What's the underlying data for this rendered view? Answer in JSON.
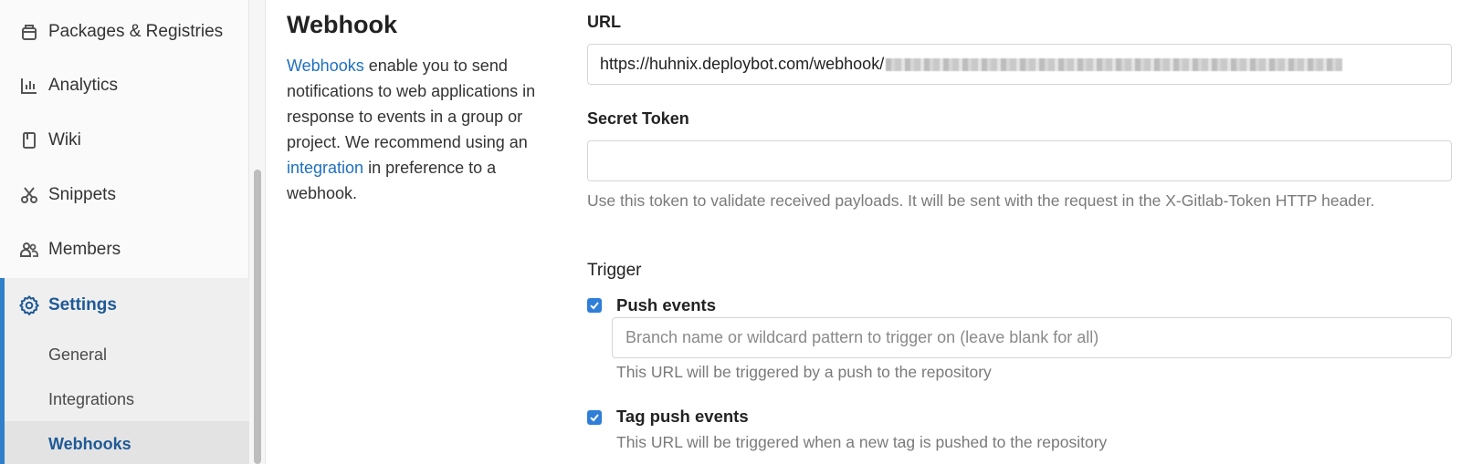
{
  "sidebar": {
    "items": [
      {
        "label": "Packages & Registries",
        "icon": "package-icon"
      },
      {
        "label": "Analytics",
        "icon": "analytics-icon"
      },
      {
        "label": "Wiki",
        "icon": "book-icon"
      },
      {
        "label": "Snippets",
        "icon": "snippet-icon"
      },
      {
        "label": "Members",
        "icon": "users-icon"
      },
      {
        "label": "Settings",
        "icon": "gear-icon"
      }
    ],
    "subitems": [
      "General",
      "Integrations",
      "Webhooks"
    ]
  },
  "description": {
    "title": "Webhook",
    "link_webhooks": "Webhooks",
    "text1": " enable you to send notifications to web applications in response to events in a group or project. We recommend using an ",
    "link_integration": "integration",
    "text2": " in preference to a webhook."
  },
  "form": {
    "url_label": "URL",
    "url_value": "https://huhnix.deploybot.com/webhook/",
    "secret_label": "Secret Token",
    "secret_value": "",
    "secret_help": "Use this token to validate received payloads. It will be sent with the request in the X-Gitlab-Token HTTP header.",
    "trigger_label": "Trigger",
    "push_label": "Push events",
    "push_checked": true,
    "branch_placeholder": "Branch name or wildcard pattern to trigger on (leave blank for all)",
    "push_help": "This URL will be triggered by a push to the repository",
    "tag_label": "Tag push events",
    "tag_checked": true,
    "tag_help": "This URL will be triggered when a new tag is pushed to the repository"
  },
  "colors": {
    "accent": "#2f7ed8",
    "active_text": "#1f5a96",
    "link": "#1f6fbf"
  }
}
